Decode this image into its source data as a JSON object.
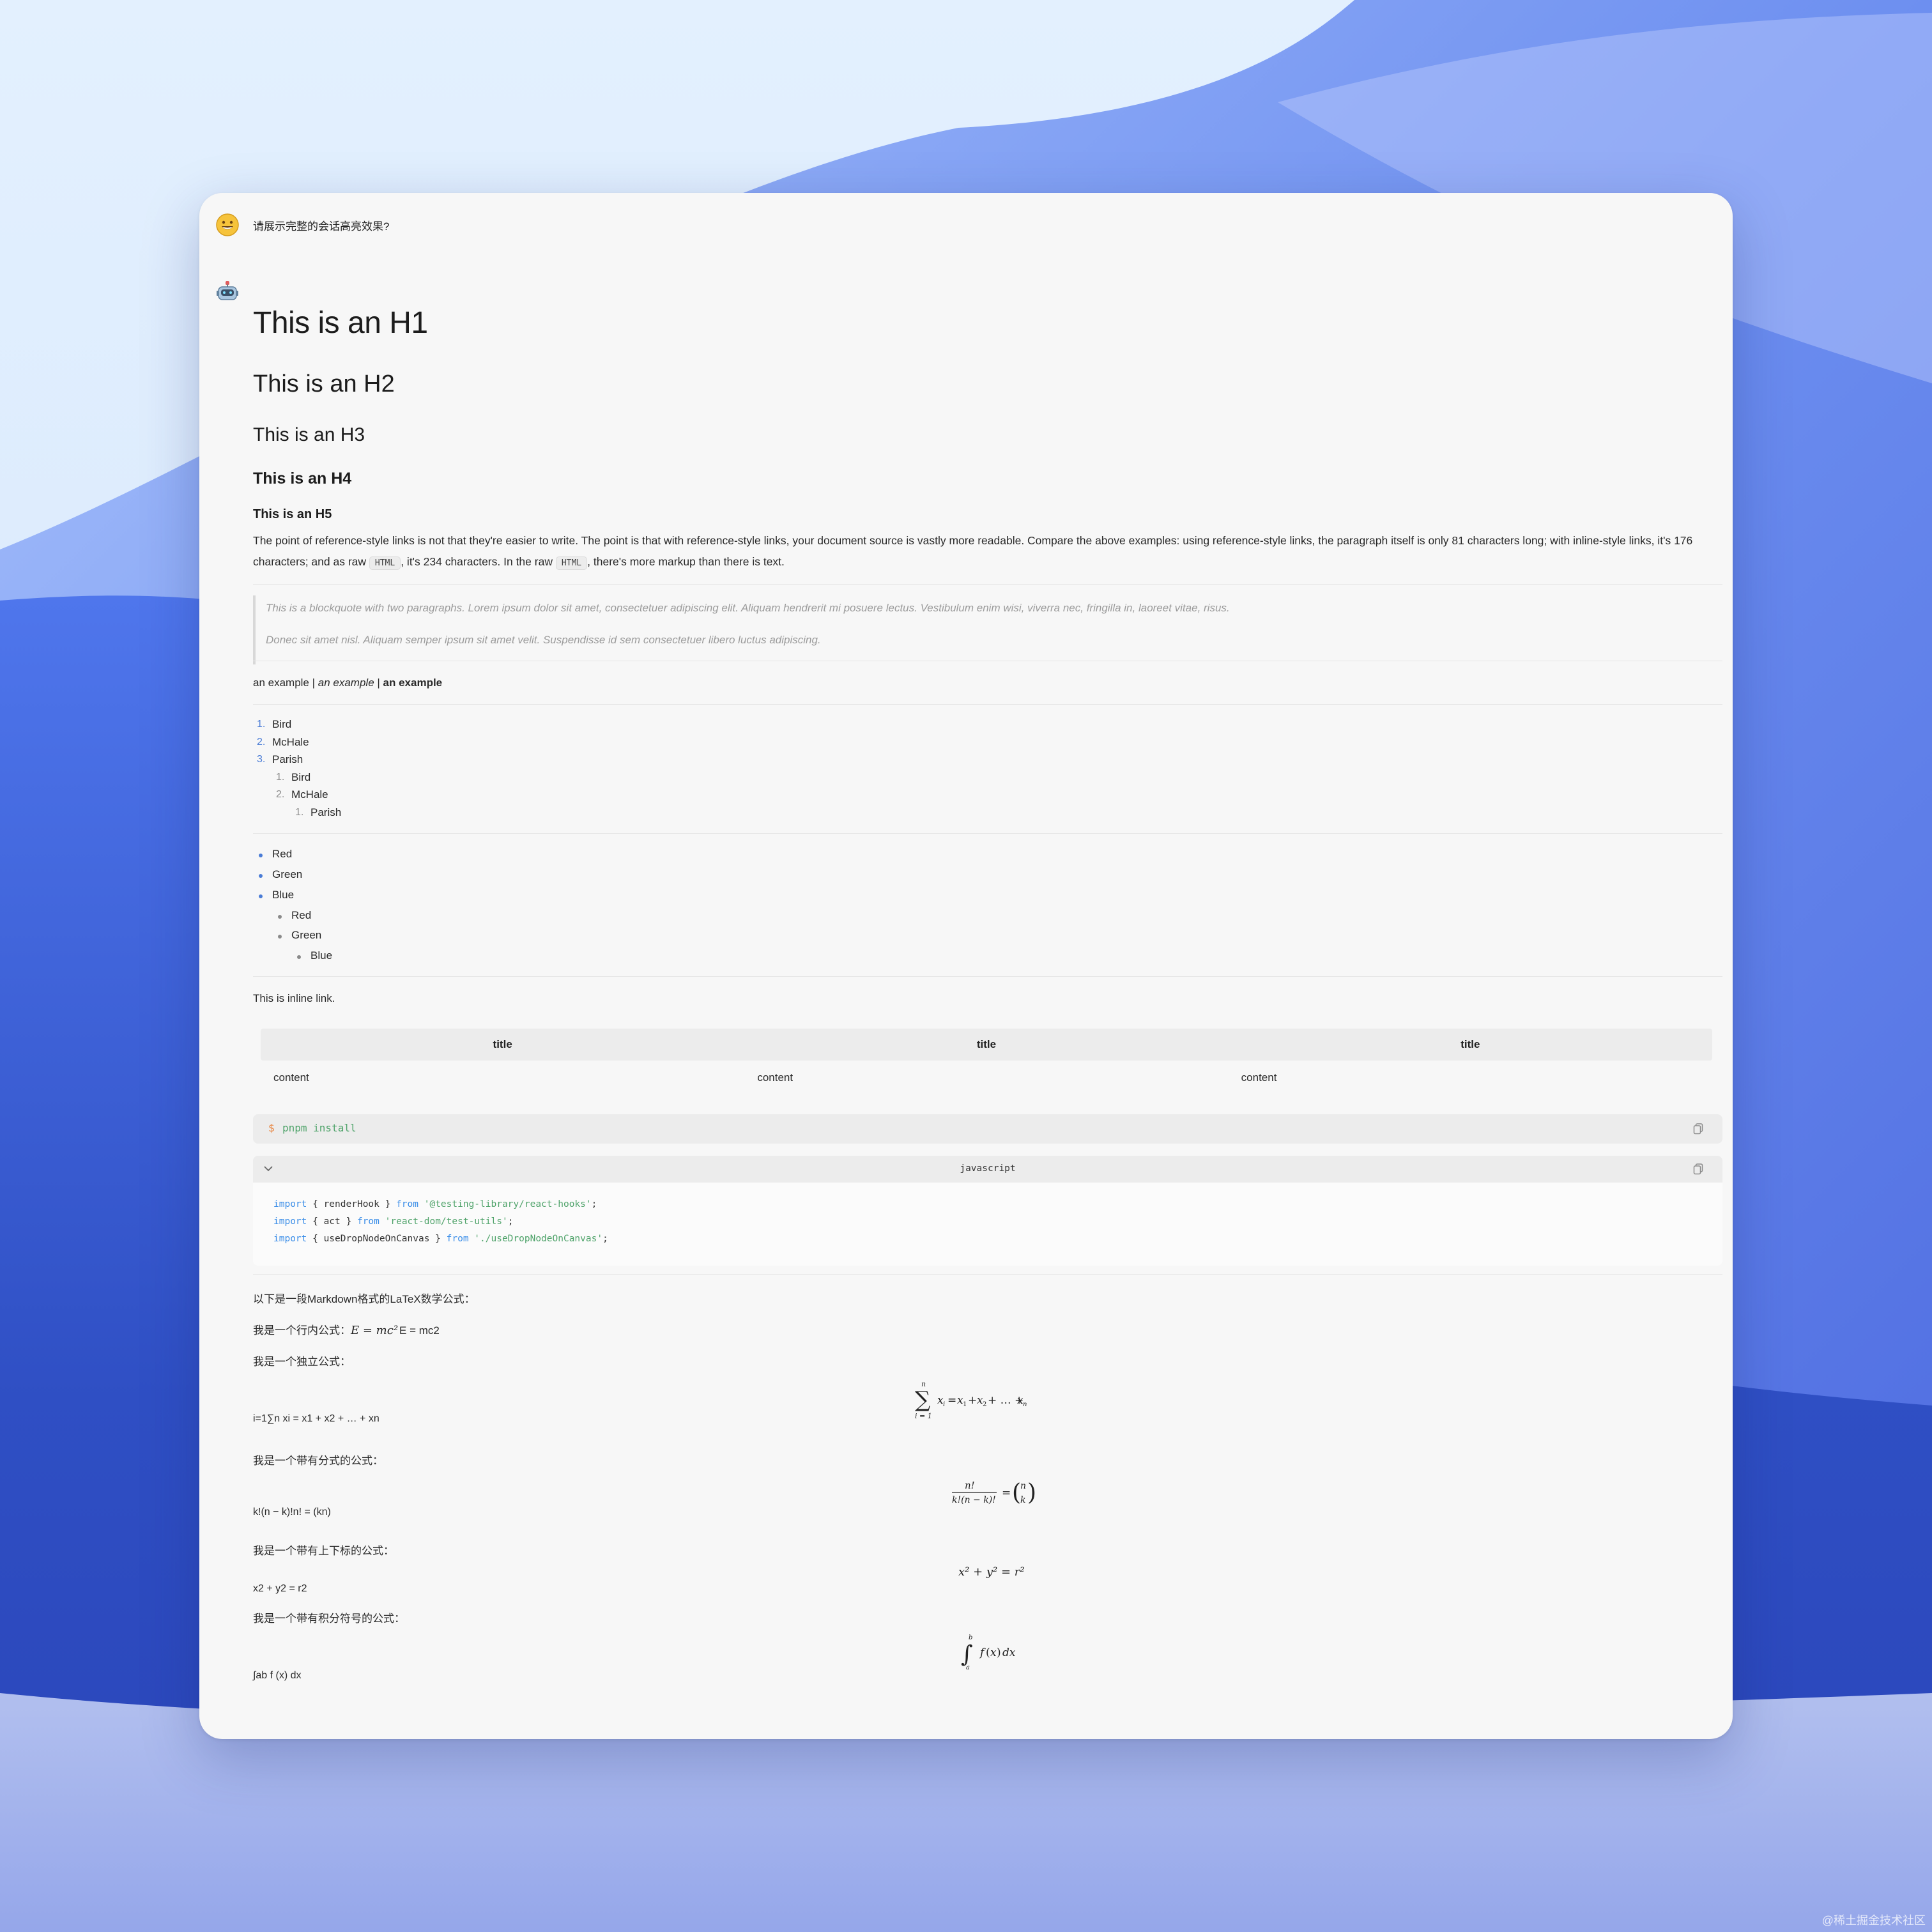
{
  "user_message": {
    "avatar_icon": "grinning-face-icon",
    "text": "请展示完整的会话高亮效果?"
  },
  "assistant": {
    "avatar_icon": "robot-icon",
    "h1": "This is an H1",
    "h2": "This is an H2",
    "h3": "This is an H3",
    "h4": "This is an H4",
    "h5": "This is an H5",
    "paragraph": {
      "part1": "The point of reference-style links is not that they're easier to write. The point is that with reference-style links, your document source is vastly more readable. Compare the above examples: using reference-style links, the paragraph itself is only 81 characters long; with inline-style links, it's 176 characters; and as raw ",
      "code1": "HTML",
      "part2": ", it's 234 characters. In the raw ",
      "code2": "HTML",
      "part3": ", there's more markup than there is text."
    },
    "blockquote": [
      "This is a blockquote with two paragraphs. Lorem ipsum dolor sit amet, consectetuer adipiscing elit. Aliquam hendrerit mi posuere lectus. Vestibulum enim wisi, viverra nec, fringilla in, laoreet vitae, risus.",
      "Donec sit amet nisl. Aliquam semper ipsum sit amet velit. Suspendisse id sem consectetuer libero luctus adipiscing."
    ],
    "emphasis": {
      "plain": "an example",
      "sep": " | ",
      "italic": "an example",
      "bold": "an example"
    },
    "ordered_list": [
      {
        "num": "1.",
        "label": "Bird"
      },
      {
        "num": "2.",
        "label": "McHale"
      },
      {
        "num": "3.",
        "label": "Parish"
      },
      {
        "num": "1.",
        "label": "Bird"
      },
      {
        "num": "2.",
        "label": "McHale"
      },
      {
        "num": "1.",
        "label": "Parish"
      }
    ],
    "unordered_list": [
      "Red",
      "Green",
      "Blue",
      "Red",
      "Green",
      "Blue"
    ],
    "inline_link_text": "This is inline link.",
    "table": {
      "headers": [
        "title",
        "title",
        "title"
      ],
      "rows": [
        [
          "content",
          "content",
          "content"
        ]
      ]
    },
    "shell_code": {
      "prompt": "$",
      "command": "pnpm install"
    },
    "js_code": {
      "language": "javascript",
      "lines": [
        {
          "kw": "import",
          "mid": " { renderHook } ",
          "from": "from",
          "str": "'@testing-library/react-hooks'",
          "end": ";"
        },
        {
          "kw": "import",
          "mid": " { act } ",
          "from": "from",
          "str": "'react-dom/test-utils'",
          "end": ";"
        },
        {
          "kw": "import",
          "mid": " { useDropNodeOnCanvas } ",
          "from": "from",
          "str": "'./useDropNodeOnCanvas'",
          "end": ";"
        }
      ]
    },
    "latex": {
      "intro": "以下是一段Markdown格式的LaTeX数学公式：",
      "inline_label": "我是一个行内公式：",
      "inline_math": "E = mc²",
      "inline_fallback": "E = mc2",
      "block_label": "我是一个独立公式：",
      "sum_fallback": "i=1∑n xi = x1 + x2 + … + xn",
      "frac_label": "我是一个带有分式的公式：",
      "frac_fallback": "k!(n − k)!n! = (kn)",
      "sup_label": "我是一个带有上下标的公式：",
      "sup_math": "x² + y² = r²",
      "sup_fallback": "x2 + y2 = r2",
      "int_label": "我是一个带有积分符号的公式：",
      "int_fallback": "∫ab f (x) dx"
    }
  },
  "watermark": "@稀土掘金技术社区",
  "colors": {
    "accent": "#4a7cd6",
    "keyword": "#3b8ee8",
    "string": "#4fa36a",
    "window_bg": "#f7f7f7"
  }
}
